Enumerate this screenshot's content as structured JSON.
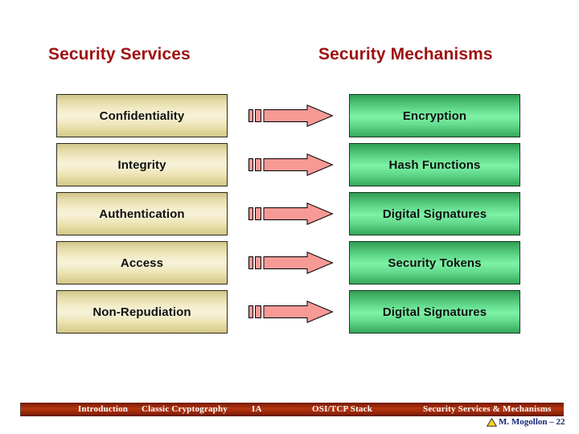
{
  "slide": {
    "title": "Security Services & Mechanisms",
    "background_color": "#ffffff"
  },
  "headings": {
    "left": "Security Services",
    "right": "Security Mechanisms",
    "color": "#9e1010"
  },
  "mapping": {
    "arrow_icon": "right-block-arrow-icon",
    "arrow_color": "#f79a96",
    "arrow_outline": "#000000",
    "service_box_color": "#eee6bf",
    "mechanism_box_color": "#5fd689",
    "rows": [
      {
        "service": "Confidentiality",
        "mechanism": "Encryption"
      },
      {
        "service": "Integrity",
        "mechanism": "Hash Functions"
      },
      {
        "service": "Authentication",
        "mechanism": "Digital Signatures"
      },
      {
        "service": "Access",
        "mechanism": "Security Tokens"
      },
      {
        "service": "Non-Repudiation",
        "mechanism": "Digital Signatures"
      }
    ]
  },
  "footer": {
    "bar_color": "#b3360f",
    "nav": [
      "Introduction",
      "Classic Cryptography",
      "IA",
      "OSI/TCP Stack",
      "Security Services & Mechanisms"
    ],
    "author_icon": "yellow-triangle-icon",
    "author": "M. Mogollon – 22",
    "author_color": "#16267a"
  }
}
